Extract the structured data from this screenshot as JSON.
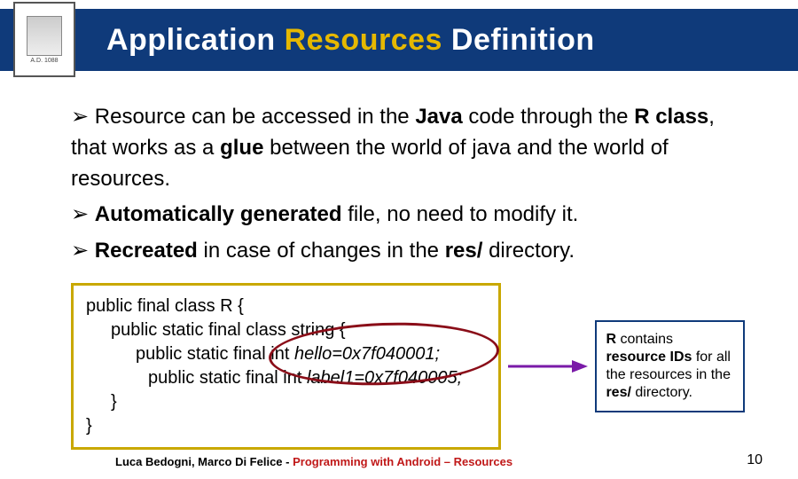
{
  "header": {
    "title_1": "Application ",
    "title_2": "Resources",
    "title_3": " Definition"
  },
  "bullets": {
    "b1_pre": "➢ Resource can be accessed in the ",
    "b1_java": "Java",
    "b1_mid": " code through the ",
    "b1_r": "R class",
    "b1_mid2": ", that works as a ",
    "b1_glue": "glue",
    "b1_post": " between the world of java and the world of resources.",
    "b2_pre": "➢ ",
    "b2_bold": "Automatically generated",
    "b2_post": " file, no need to modify  it.",
    "b3_pre": "➢ ",
    "b3_bold": "Recreated",
    "b3_post": " in case of changes in the ",
    "b3_res": "res/",
    "b3_post2": " directory."
  },
  "code": {
    "l1": "public final class R {",
    "l2": "public static final class string {",
    "l3a": "public static final int ",
    "l3b": "hello=0x7f040001;",
    "l4a": "public static final int ",
    "l4b": "label1=0x7f040005;",
    "l5": "}",
    "l6": "}"
  },
  "note": {
    "t1": "R",
    "t2": " contains ",
    "t3": "resource IDs",
    "t4": " for all the resources in the ",
    "t5": "res/",
    "t6": " directory."
  },
  "footer": {
    "authors": "Luca Bedogni, Marco Di Felice",
    "dash": " - ",
    "course": "Programming with Android – Resources",
    "page": "10"
  }
}
